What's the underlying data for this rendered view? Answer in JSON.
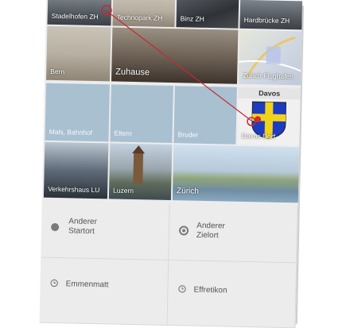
{
  "tiles_row0": [
    "Stadelhofen ZH",
    "Technopark ZH",
    "Binz ZH",
    "Hardbrücke ZH"
  ],
  "tiles_row1": [
    "Bern",
    "Zuhause",
    "Zürich Flughafen"
  ],
  "tiles_row2": [
    "Mals, Bahnhof",
    "Eltern",
    "Bruder"
  ],
  "davos": {
    "header": "Davos",
    "label": "Davos Dorf"
  },
  "tiles_row3": [
    "Verkehrshaus LU",
    "Luzern",
    "Zürich"
  ],
  "options": {
    "start": {
      "line1": "Anderer",
      "line2": "Startort"
    },
    "destination": {
      "line1": "Anderer",
      "line2": "Zielort"
    }
  },
  "recent": [
    "Emmenmatt",
    "Effretikon"
  ],
  "colors": {
    "tile_blue": "#a9c0d1",
    "annotation_line": "#c22a33"
  },
  "icons": [
    "dot-icon",
    "target-icon",
    "history-icon",
    "coat-of-arms-icon"
  ]
}
